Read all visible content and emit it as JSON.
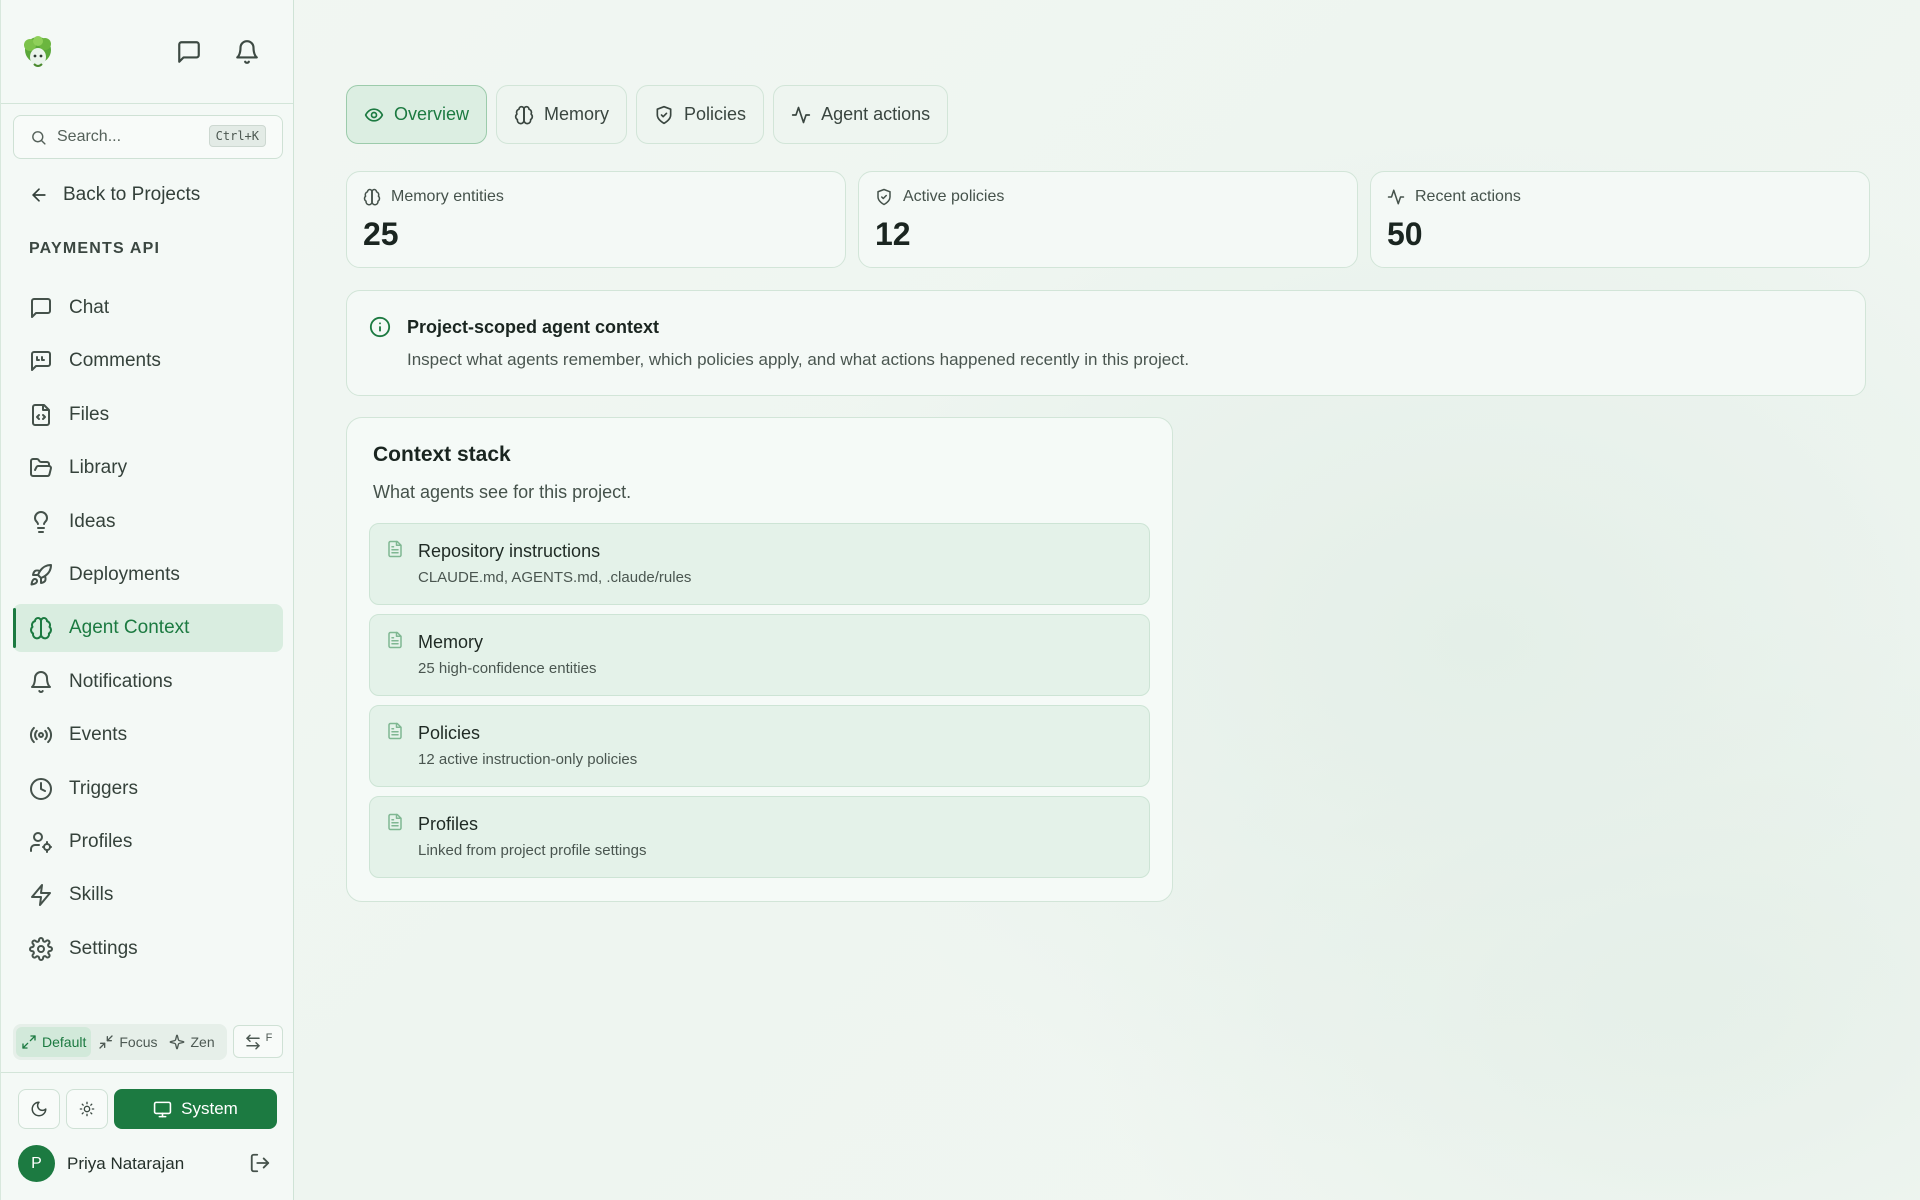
{
  "sidebar": {
    "search": {
      "placeholder": "Search...",
      "shortcut": "Ctrl+K"
    },
    "back_label": "Back to Projects",
    "project_name": "PAYMENTS API",
    "nav": [
      {
        "label": "Chat",
        "icon": "message-square-icon"
      },
      {
        "label": "Comments",
        "icon": "message-quote-icon"
      },
      {
        "label": "Files",
        "icon": "file-code-icon"
      },
      {
        "label": "Library",
        "icon": "folder-open-icon"
      },
      {
        "label": "Ideas",
        "icon": "lightbulb-icon"
      },
      {
        "label": "Deployments",
        "icon": "rocket-icon"
      },
      {
        "label": "Agent Context",
        "icon": "brain-icon",
        "active": true
      },
      {
        "label": "Notifications",
        "icon": "bell-icon"
      },
      {
        "label": "Events",
        "icon": "radio-icon"
      },
      {
        "label": "Triggers",
        "icon": "clock-icon"
      },
      {
        "label": "Profiles",
        "icon": "user-cog-icon"
      },
      {
        "label": "Skills",
        "icon": "zap-icon"
      },
      {
        "label": "Settings",
        "icon": "settings-icon"
      }
    ],
    "modes": {
      "default": "Default",
      "focus": "Focus",
      "zen": "Zen",
      "swap_key": "F"
    },
    "theme": {
      "system_label": "System"
    },
    "user": {
      "initial": "P",
      "name": "Priya Natarajan"
    }
  },
  "tabs": [
    {
      "label": "Overview",
      "icon": "eye-icon",
      "active": true
    },
    {
      "label": "Memory",
      "icon": "brain-icon"
    },
    {
      "label": "Policies",
      "icon": "shield-check-icon"
    },
    {
      "label": "Agent actions",
      "icon": "activity-icon"
    }
  ],
  "stats": [
    {
      "label": "Memory entities",
      "value": "25",
      "icon": "brain-icon"
    },
    {
      "label": "Active policies",
      "value": "12",
      "icon": "shield-check-icon"
    },
    {
      "label": "Recent actions",
      "value": "50",
      "icon": "activity-icon"
    }
  ],
  "info": {
    "title": "Project-scoped agent context",
    "description": "Inspect what agents remember, which policies apply, and what actions happened recently in this project."
  },
  "context_stack": {
    "title": "Context stack",
    "subtitle": "What agents see for this project.",
    "items": [
      {
        "title": "Repository instructions",
        "detail": "CLAUDE.md, AGENTS.md, .claude/rules"
      },
      {
        "title": "Memory",
        "detail": "25 high-confidence entities"
      },
      {
        "title": "Policies",
        "detail": "12 active instruction-only policies"
      },
      {
        "title": "Profiles",
        "detail": "Linked from project profile settings"
      }
    ]
  },
  "colors": {
    "accent": "#1c7a41",
    "background": "#eff6f1",
    "card": "#f4f9f6",
    "border": "#d2e5d8"
  }
}
